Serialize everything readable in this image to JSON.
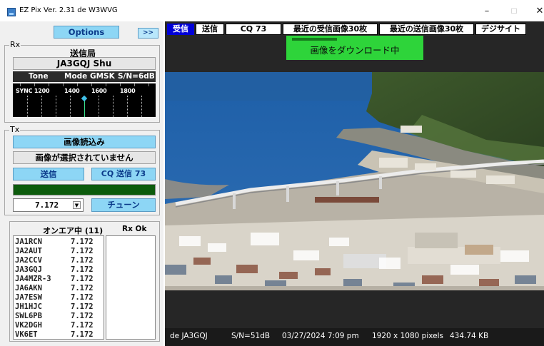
{
  "titlebar": {
    "app_title": "EZ Pix",
    "version": "Ver. 2.31 de W3WVG",
    "minimize": "–",
    "maximize": "☐",
    "close": "✕"
  },
  "top": {
    "options_label": "Options",
    "expand_label": ">>"
  },
  "rx": {
    "legend": "Rx",
    "station_label": "送信局",
    "callsign": "JA3GQJ  Shu",
    "tone": "Tone",
    "mode": "Mode GMSK",
    "sn": "S/N=6dB",
    "waterfall_labels": [
      "SYNC 1200",
      "1400",
      "1600",
      "1800"
    ]
  },
  "tx": {
    "legend": "Tx",
    "load_label": "画像読込み",
    "no_image_label": "画像が選択されていません",
    "send_label": "送信",
    "cq_send_label": "CQ  送信  73",
    "frequency": "7.172",
    "tune_label": "チューン"
  },
  "list": {
    "onair_header": "オンエア中 (11)",
    "rxok_header": "Rx Ok",
    "stations": [
      {
        "call": "JA1RCN",
        "freq": "7.172"
      },
      {
        "call": "JA2AUT",
        "freq": "7.172"
      },
      {
        "call": "JA2CCV",
        "freq": "7.172"
      },
      {
        "call": "JA3GQJ",
        "freq": "7.172"
      },
      {
        "call": "JA4MZR-3",
        "freq": "7.172"
      },
      {
        "call": "JA6AKN",
        "freq": "7.172"
      },
      {
        "call": "JA7ESW",
        "freq": "7.172"
      },
      {
        "call": "JH1HJC",
        "freq": "7.172"
      },
      {
        "call": "SWL6PB",
        "freq": "7.172"
      },
      {
        "call": "VK2DGH",
        "freq": "7.172"
      },
      {
        "call": "VK6ET",
        "freq": "7.172"
      }
    ]
  },
  "tabs": [
    "受信",
    "送信",
    "CQ 73",
    "最近の受信画像30枚",
    "最近の送信画像30枚",
    "デジサイト"
  ],
  "download": {
    "text": "画像をダウンロード中",
    "progress": 0.33
  },
  "status": {
    "from": "de JA3GQJ",
    "sn": "S/N=51dB",
    "datetime": "03/27/2024  7:09 pm",
    "resolution": "1920 x 1080 pixels",
    "size": "434.74 KB"
  },
  "colors": {
    "button_blue": "#8dd6f5",
    "tab_active": "#0000d8",
    "progress_green": "#2ed43a",
    "tx_bar": "#0c5b0c"
  }
}
